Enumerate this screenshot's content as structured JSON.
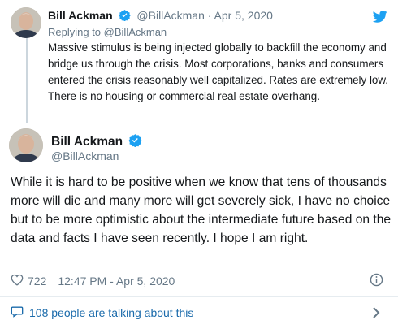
{
  "parent_tweet": {
    "author_name": "Bill Ackman",
    "author_handle": "@BillAckman",
    "separator": "·",
    "date": "Apr 5, 2020",
    "replying_prefix": "Replying to",
    "replying_to": "@BillAckman",
    "text": "Massive stimulus is being injected globally to backfill the economy and  bridge us through the crisis. Most corporations, banks and consumers entered the crisis reasonably well capitalized. Rates are extremely low. There is no housing or commercial real estate overhang."
  },
  "main_tweet": {
    "author_name": "Bill Ackman",
    "author_handle": "@BillAckman",
    "text": "While it is hard to be positive when we know that tens of thousands more will die and many more will get severely sick, I have no choice but to be more optimistic about the intermediate future based on the data and facts I have seen recently. I hope I am right.",
    "likes": "722",
    "timestamp": "12:47 PM - Apr 5, 2020"
  },
  "conversation": {
    "label": "108 people are talking about this"
  },
  "icons": {
    "verified": "verified-badge-icon",
    "twitter": "twitter-bird-icon",
    "like": "heart-icon",
    "info": "info-icon",
    "reply": "speech-bubble-icon",
    "chevron": "chevron-right-icon"
  },
  "colors": {
    "accent": "#1da1f2",
    "link": "#1b6bab",
    "muted": "#657786",
    "text": "#14171a"
  }
}
